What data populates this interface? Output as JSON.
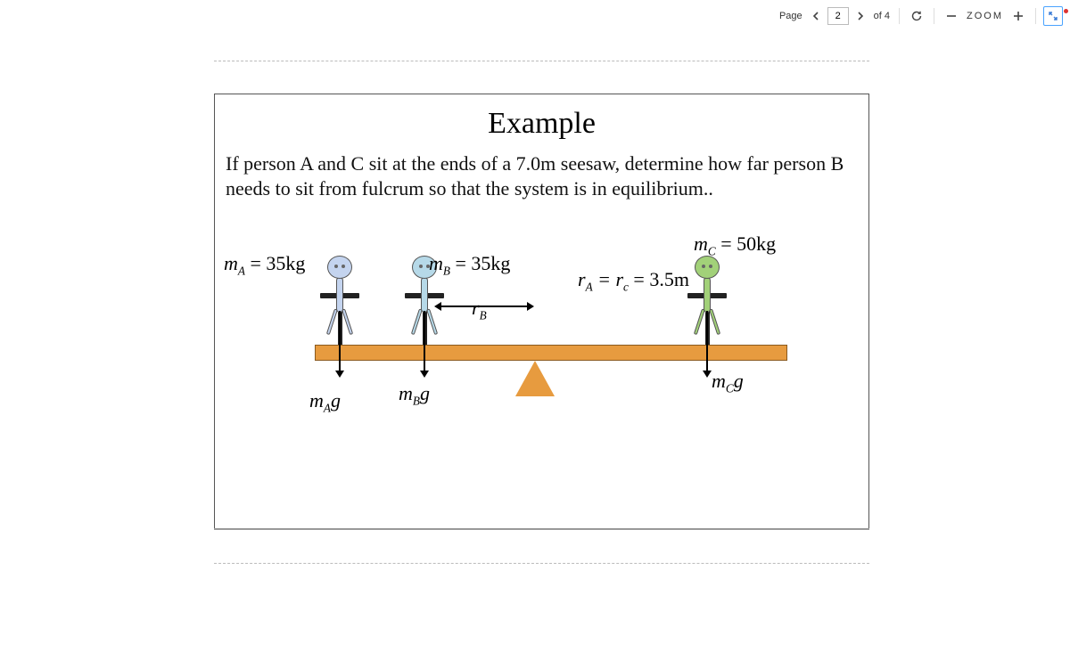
{
  "toolbar": {
    "page_label": "Page",
    "current_page": "2",
    "of_label": "of 4",
    "zoom_label": "ZOOM"
  },
  "doc": {
    "title": "Example",
    "problem": "If person A and C sit at the ends of a 7.0m seesaw, determine how far person B needs to sit from fulcrum so that the system is in equilibrium..",
    "mA_prefix": "m",
    "mA_sub": "A",
    "mA_eq": " = 35kg",
    "mB_prefix": "m",
    "mB_sub": "B",
    "mB_eq": " = 35kg",
    "mC_prefix": "m",
    "mC_sub": "C",
    "mC_eq": " = 50kg",
    "rAc_1": "r",
    "rAc_s1": "A",
    "rAc_mid": " = r",
    "rAc_s2": "c",
    "rAc_eq": " = 3.5m",
    "rB_prefix": "r",
    "rB_sub": "B",
    "fA_m": "m",
    "fA_s": "A",
    "fA_g": "g",
    "fB_m": "m",
    "fB_s": "B",
    "fB_g": "g",
    "fC_m": "m",
    "fC_s": "C",
    "fC_g": "g"
  }
}
